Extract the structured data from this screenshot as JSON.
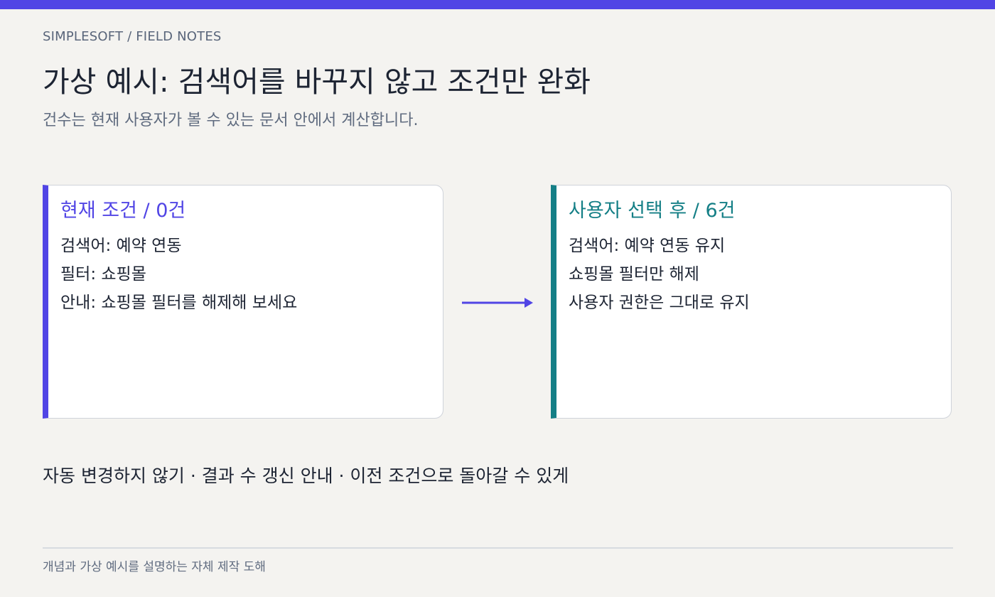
{
  "breadcrumb": "SIMPLESOFT / FIELD NOTES",
  "title": "가상 예시: 검색어를 바꾸지 않고 조건만 완화",
  "subtitle": "건수는 현재 사용자가 볼 수 있는 문서 안에서 계산합니다.",
  "cards": [
    {
      "title": "현재 조건 / 0건",
      "lines": [
        "검색어: 예약 연동",
        "필터: 쇼핑몰",
        "안내: 쇼핑몰 필터를 해제해 보세요"
      ],
      "accent": "#5145e5"
    },
    {
      "title": "사용자 선택 후 / 6건",
      "lines": [
        "검색어: 예약 연동 유지",
        "쇼핑몰 필터만 해제",
        "사용자 권한은 그대로 유지"
      ],
      "accent": "#147f86"
    }
  ],
  "arrow_icon": "right-arrow-icon",
  "footer_note": "자동 변경하지 않기 · 결과 수 갱신 안내 · 이전 조건으로 돌아갈 수 있게",
  "caption": "개념과 가상 예시를 설명하는 자체 제작 도해",
  "colors": {
    "top_bar": "#5145e5",
    "background": "#f4f3f0",
    "card_border": "#cfd3da"
  }
}
